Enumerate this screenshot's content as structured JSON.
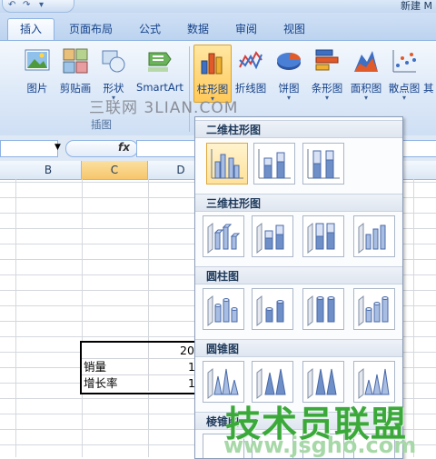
{
  "window": {
    "title": "新建 M"
  },
  "tabs": [
    {
      "label": "插入"
    },
    {
      "label": "页面布局"
    },
    {
      "label": "公式"
    },
    {
      "label": "数据"
    },
    {
      "label": "审阅"
    },
    {
      "label": "视图"
    }
  ],
  "ribbon": {
    "illustrations": {
      "picture": "图片",
      "clipart": "剪贴画",
      "shapes": "形状",
      "smartart": "SmartArt",
      "group_label": "插图"
    },
    "charts": {
      "column": "柱形图",
      "line": "折线图",
      "pie": "饼图",
      "bar": "条形图",
      "area": "面积图",
      "scatter": "散点图",
      "other": "其"
    },
    "dropdown_glyph": "▾",
    "watermark": "三联网 3LIAN.COM"
  },
  "formula_bar": {
    "fx": "fx",
    "namebox_arrow": "▼"
  },
  "columns": [
    "B",
    "C",
    "D"
  ],
  "sheet_table": {
    "header_value": "20",
    "rows": [
      {
        "label": "销量",
        "value": "1"
      },
      {
        "label": "增长率",
        "value": "1"
      }
    ]
  },
  "gallery": {
    "sections": [
      {
        "title": "二维柱形图"
      },
      {
        "title": "三维柱形图"
      },
      {
        "title": "圆柱图"
      },
      {
        "title": "圆锥图"
      },
      {
        "title": "棱锥图"
      }
    ]
  },
  "watermark": {
    "logo": "技术员联盟",
    "url": "www.jsgho.com"
  },
  "colors": {
    "accent": "#15428b",
    "selected": "#ffc95a",
    "logo": "#3aa93a"
  }
}
